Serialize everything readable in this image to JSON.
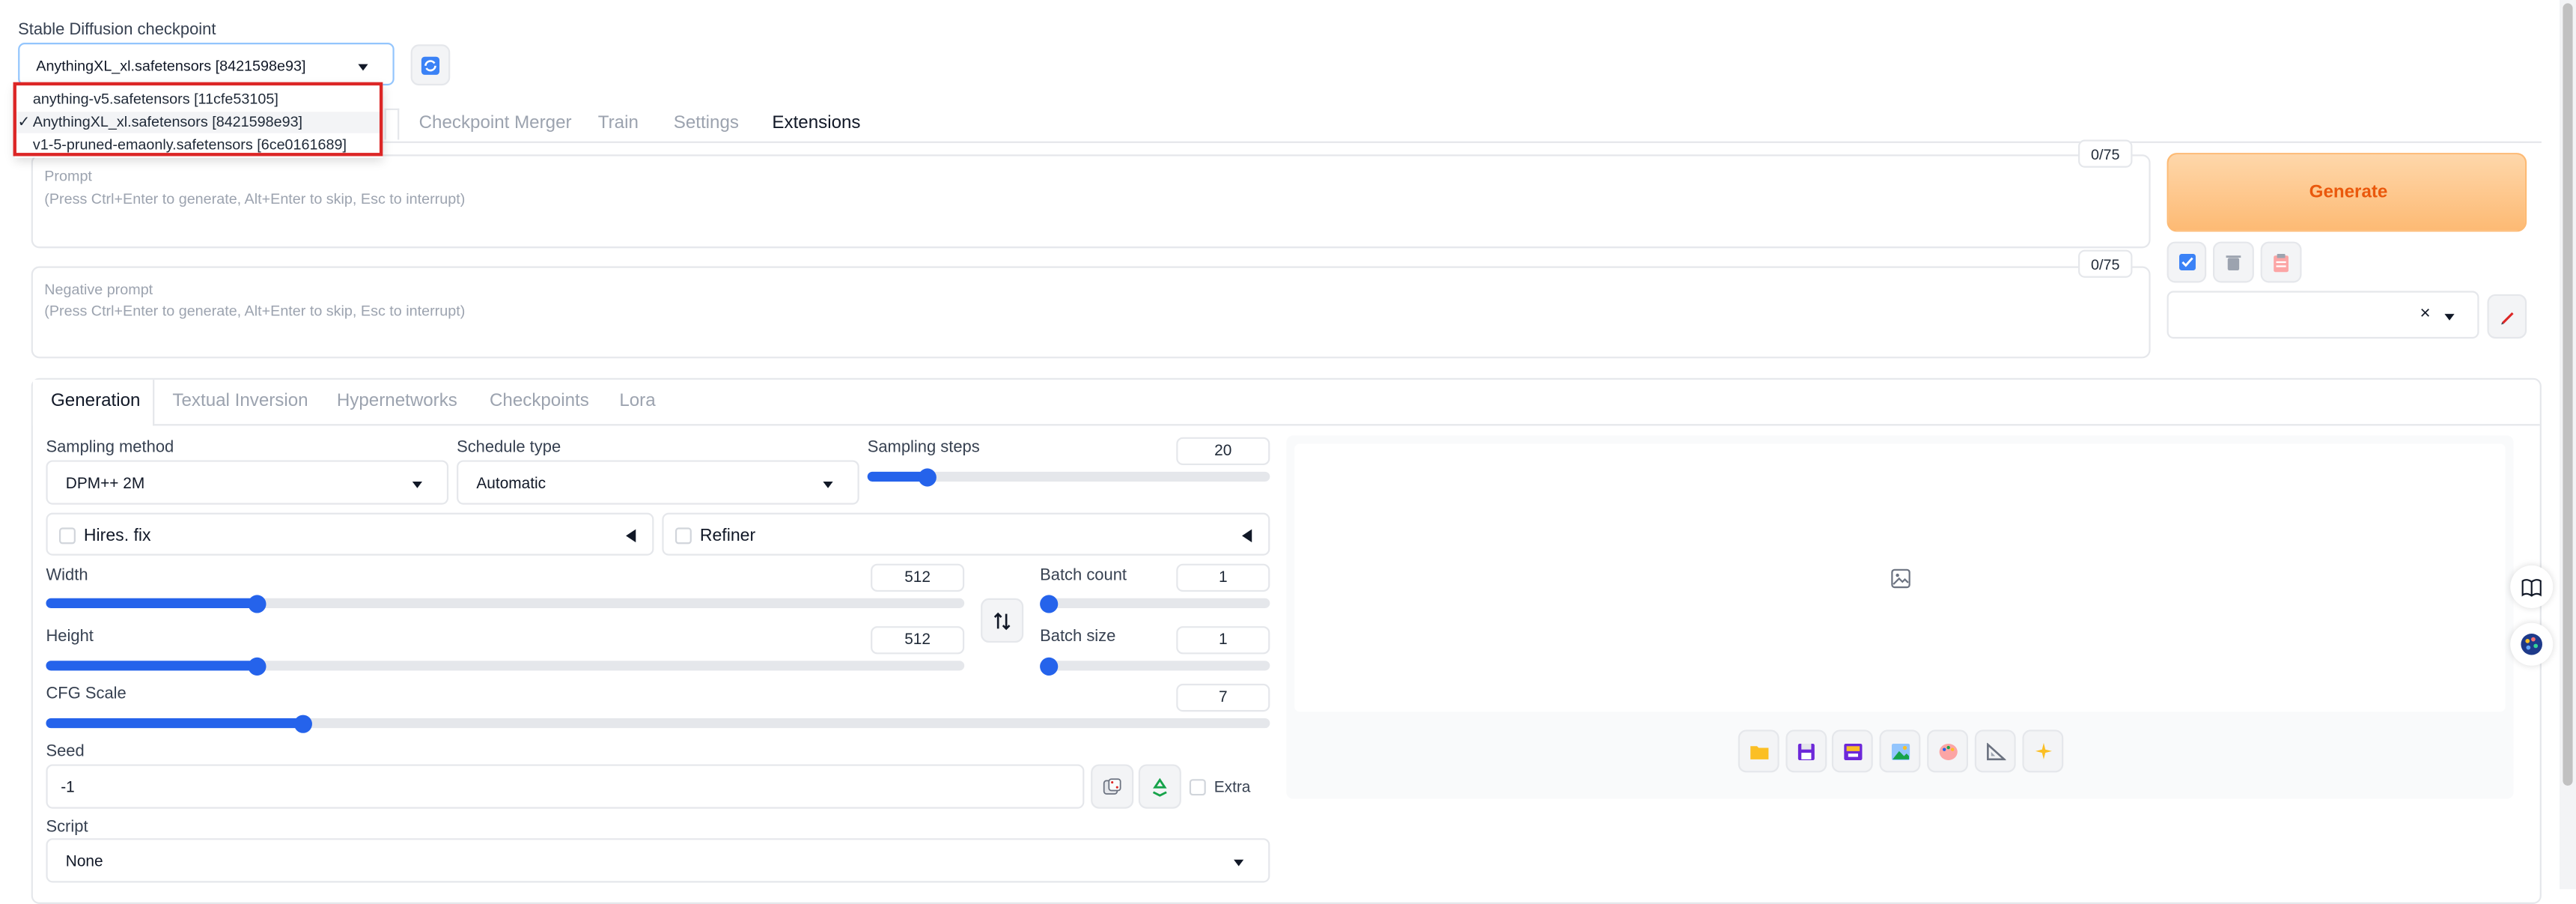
{
  "checkpoint": {
    "label": "Stable Diffusion checkpoint",
    "selected": "AnythingXL_xl.safetensors [8421598e93]",
    "options": [
      {
        "name": "anything-v5.safetensors [11cfe53105]",
        "check": ""
      },
      {
        "name": "AnythingXL_xl.safetensors [8421598e93]",
        "check": "✓"
      },
      {
        "name": "v1-5-pruned-emaonly.safetensors [6ce0161689]",
        "check": ""
      }
    ]
  },
  "top_tabs": [
    "Checkpoint Merger",
    "Train",
    "Settings",
    "Extensions"
  ],
  "prompt": {
    "label": "Prompt",
    "placeholder": "(Press Ctrl+Enter to generate, Alt+Enter to skip, Esc to interrupt)",
    "counter": "0/75"
  },
  "negative_prompt": {
    "label": "Negative prompt",
    "placeholder": "(Press Ctrl+Enter to generate, Alt+Enter to skip, Esc to interrupt)",
    "counter": "0/75"
  },
  "generate_label": "Generate",
  "clear_symbol": "×",
  "sub_tabs": [
    "Generation",
    "Textual Inversion",
    "Hypernetworks",
    "Checkpoints",
    "Lora"
  ],
  "sampling": {
    "label": "Sampling method",
    "value": "DPM++ 2M"
  },
  "schedule": {
    "label": "Schedule type",
    "value": "Automatic"
  },
  "steps": {
    "label": "Sampling steps",
    "value": "20",
    "fraction": 0.15
  },
  "hires": {
    "label": "Hires. fix"
  },
  "refiner": {
    "label": "Refiner"
  },
  "width": {
    "label": "Width",
    "value": "512",
    "fraction": 0.23
  },
  "height": {
    "label": "Height",
    "value": "512",
    "fraction": 0.23
  },
  "batch_count": {
    "label": "Batch count",
    "value": "1",
    "fraction": 0.0
  },
  "batch_size": {
    "label": "Batch size",
    "value": "1",
    "fraction": 0.0
  },
  "cfg": {
    "label": "CFG Scale",
    "value": "7",
    "fraction": 0.21
  },
  "seed": {
    "label": "Seed",
    "value": "-1",
    "extra_label": "Extra"
  },
  "script": {
    "label": "Script",
    "value": "None"
  },
  "colors": {
    "accent": "#2563eb",
    "generate_text": "#ea580c",
    "highlight": "#dc2626"
  }
}
